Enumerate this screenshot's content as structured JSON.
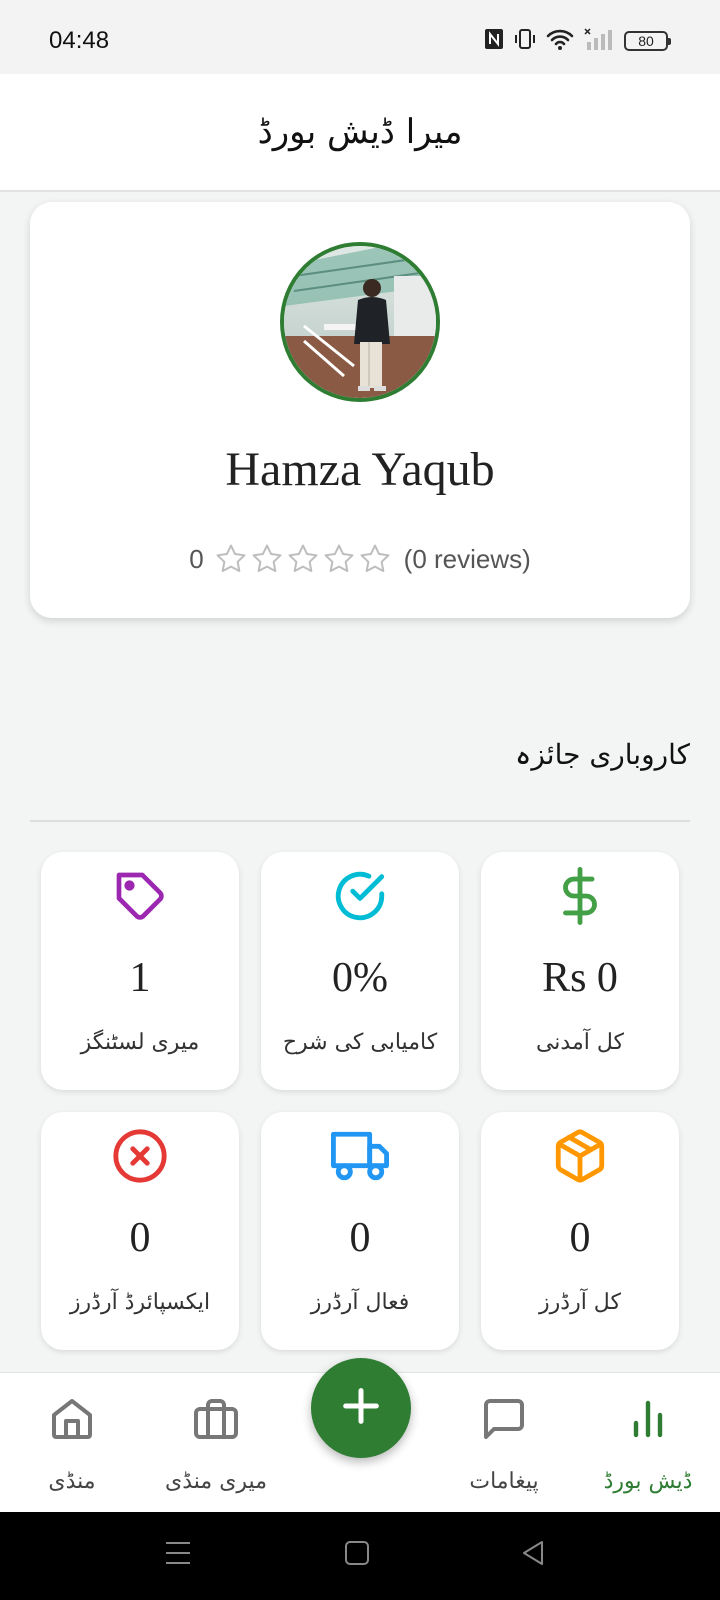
{
  "status_bar": {
    "time": "04:48",
    "battery": "80",
    "icons": [
      "nfc-icon",
      "vibrate-icon",
      "wifi-icon",
      "signal-icon",
      "battery-icon"
    ]
  },
  "header": {
    "title": "میرا ڈیش بورڈ"
  },
  "profile": {
    "name": "Hamza Yaqub",
    "rating_value": "0",
    "rating": 0,
    "max_stars": 5,
    "reviews": "(0 reviews)"
  },
  "section": {
    "title": "کاروباری جائزہ"
  },
  "stats": [
    {
      "value": "1",
      "label": "میری لسٹنگز",
      "icon": "tag-icon",
      "color": "#9c27b0"
    },
    {
      "value": "0%",
      "label": "کامیابی کی شرح",
      "icon": "check-circle-icon",
      "color": "#00bcd4"
    },
    {
      "value": "Rs 0",
      "label": "کل آمدنی",
      "icon": "dollar-icon",
      "color": "#43a047"
    },
    {
      "value": "0",
      "label": "ایکسپائرڈ آرڈرز",
      "icon": "x-circle-icon",
      "color": "#e53935"
    },
    {
      "value": "0",
      "label": "فعال آرڈرز",
      "icon": "truck-icon",
      "color": "#2196f3"
    },
    {
      "value": "0",
      "label": "کل آرڈرز",
      "icon": "package-icon",
      "color": "#ff9800"
    }
  ],
  "bottom_nav": {
    "items": [
      {
        "label": "منڈی",
        "icon": "home-icon",
        "active": false
      },
      {
        "label": "میری منڈی",
        "icon": "briefcase-icon",
        "active": false
      },
      {
        "label": "پیغامات",
        "icon": "chat-icon",
        "active": false
      },
      {
        "label": "ڈیش بورڈ",
        "icon": "bar-chart-icon",
        "active": true
      }
    ],
    "fab_icon": "plus-icon"
  },
  "colors": {
    "primary": "#2e7d32",
    "background": "#f3f4f4",
    "card": "#ffffff"
  }
}
